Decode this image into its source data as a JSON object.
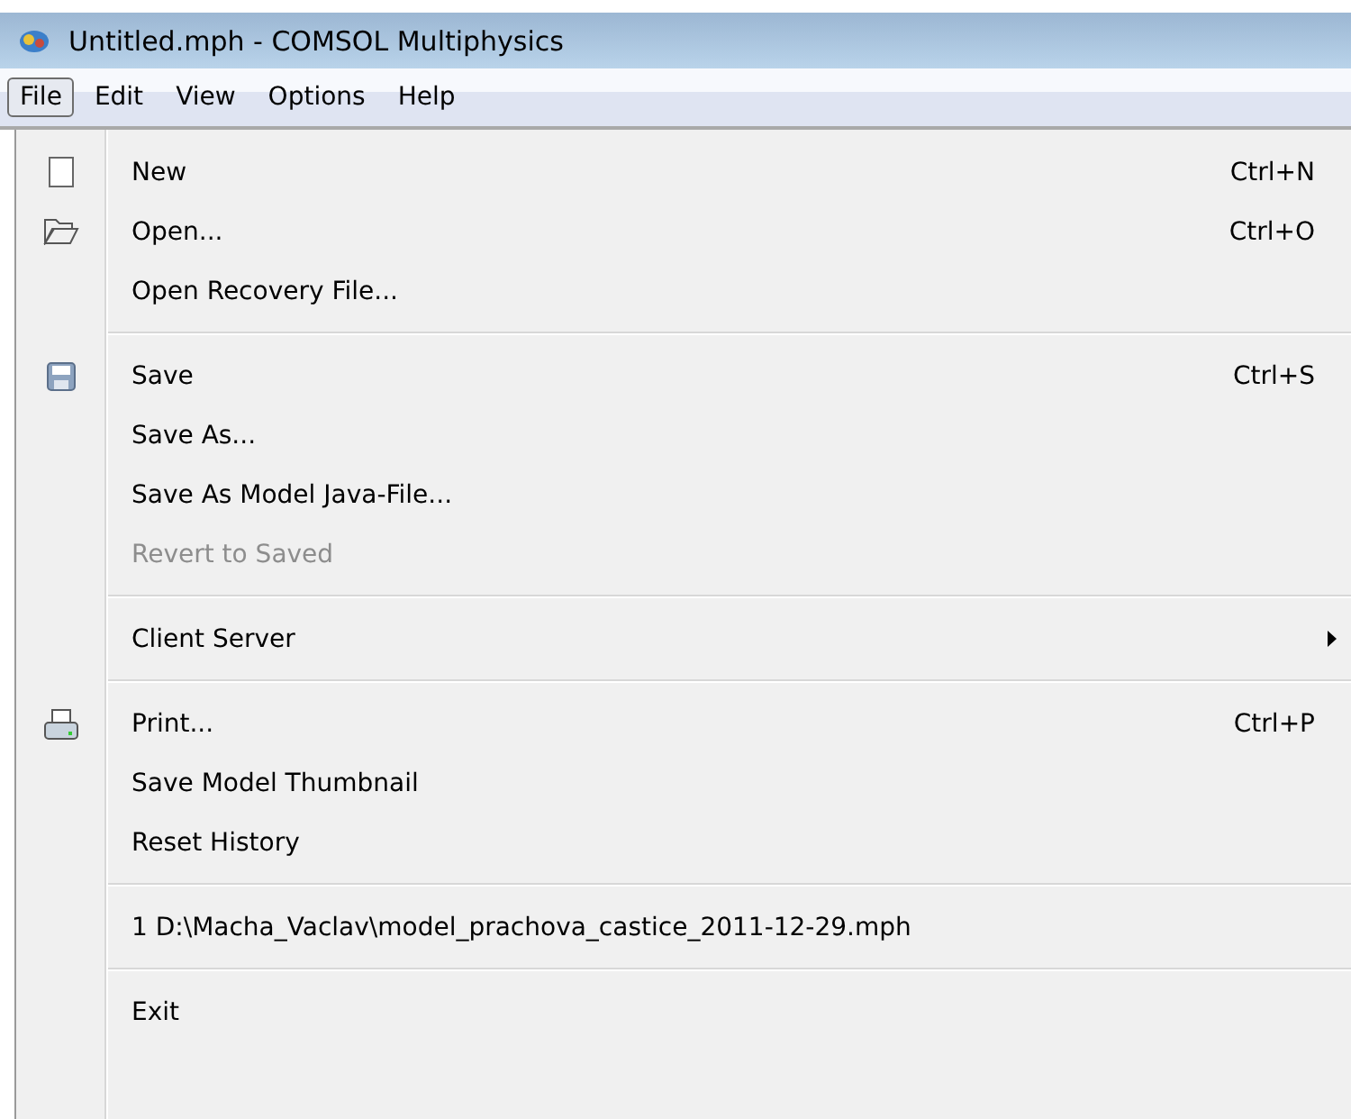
{
  "window": {
    "title": "Untitled.mph - COMSOL Multiphysics"
  },
  "menu_bar": [
    {
      "label": "File",
      "selected": true
    },
    {
      "label": "Edit",
      "selected": false
    },
    {
      "label": "View",
      "selected": false
    },
    {
      "label": "Options",
      "selected": false
    },
    {
      "label": "Help",
      "selected": false
    }
  ],
  "file_menu": [
    {
      "kind": "item",
      "label": "New",
      "shortcut": "Ctrl+N",
      "disabled": false
    },
    {
      "kind": "item",
      "label": "Open...",
      "shortcut": "Ctrl+O",
      "disabled": false
    },
    {
      "kind": "item",
      "label": "Open Recovery File...",
      "disabled": false
    },
    {
      "kind": "separator"
    },
    {
      "kind": "item",
      "label": "Save",
      "shortcut": "Ctrl+S",
      "disabled": false
    },
    {
      "kind": "item",
      "label": "Save As...",
      "disabled": false
    },
    {
      "kind": "item",
      "label": "Save As Model Java-File...",
      "disabled": false
    },
    {
      "kind": "item",
      "label": "Revert to Saved",
      "disabled": true
    },
    {
      "kind": "separator"
    },
    {
      "kind": "item",
      "label": "Client Server",
      "submenu": true,
      "disabled": false
    },
    {
      "kind": "separator"
    },
    {
      "kind": "item",
      "label": "Print...",
      "shortcut": "Ctrl+P",
      "disabled": false
    },
    {
      "kind": "item",
      "label": "Save Model Thumbnail",
      "disabled": false
    },
    {
      "kind": "item",
      "label": "Reset History",
      "disabled": false
    },
    {
      "kind": "separator"
    },
    {
      "kind": "item",
      "label": "1 D:\\Macha_Vaclav\\model_prachova_castice_2011-12-29.mph",
      "disabled": false
    },
    {
      "kind": "separator"
    },
    {
      "kind": "item",
      "label": "Exit",
      "disabled": false
    }
  ]
}
